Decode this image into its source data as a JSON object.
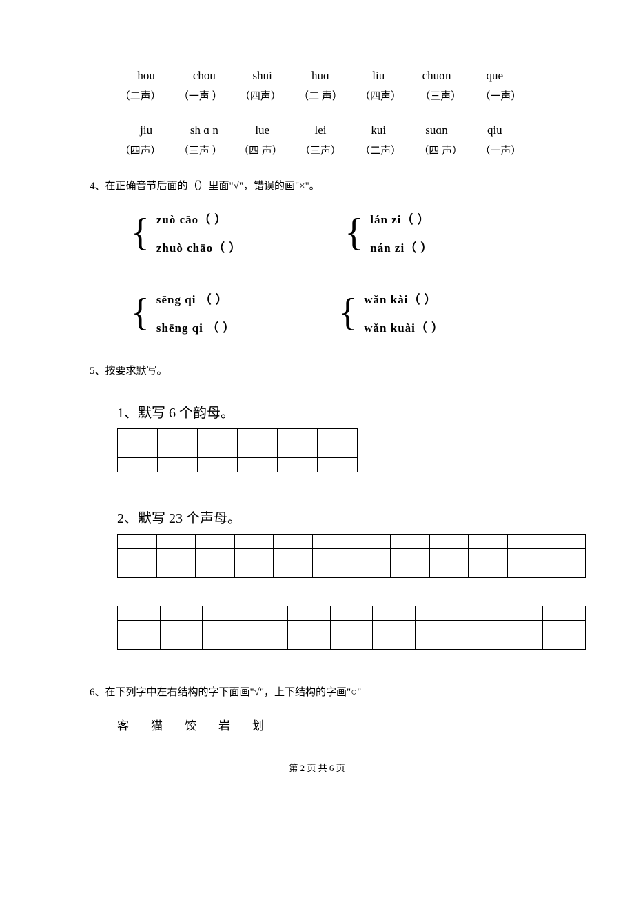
{
  "row1_pinyin": [
    "hou",
    "chou",
    "shui",
    "huɑ",
    "liu",
    "chuɑn",
    "que"
  ],
  "row1_tones": [
    "（二声）",
    "（一声 ）",
    "（四声）",
    "（二 声）",
    "（四声）",
    "（三声）",
    "（一声）"
  ],
  "row2_pinyin": [
    "jiu",
    "sh ɑ n",
    "lue",
    "lei",
    "kui",
    "suɑn",
    "qiu"
  ],
  "row2_tones": [
    "（四声）",
    "（三声 ）",
    "（四 声）",
    "（三声）",
    "（二声）",
    "（四 声）",
    "（一声）"
  ],
  "q4": "4、在正确音节后面的（）里面\"√\"，错误的画\"×\"。",
  "bracket1": {
    "a": "zuò  cāo（  ）",
    "b": "zhuò  chāo（  ）"
  },
  "bracket2": {
    "a": "lán  zi（  ）",
    "b": "nán  zi（  ）"
  },
  "bracket3": {
    "a": "sēng  qi  （  ）",
    "b": "shēng  qi  （  ）"
  },
  "bracket4": {
    "a": "wǎn  kài（  ）",
    "b": "wǎn  kuài（  ）"
  },
  "q5": "5、按要求默写。",
  "sub1": "1、默写 6 个韵母。",
  "sub2": "2、默写 23 个声母。",
  "q6": "6、在下列字中左右结构的字下面画\"√\"，上下结构的字画\"○\"",
  "chars": [
    "客",
    "猫",
    "饺",
    "岩",
    "划"
  ],
  "footer": "第 2 页 共 6 页"
}
